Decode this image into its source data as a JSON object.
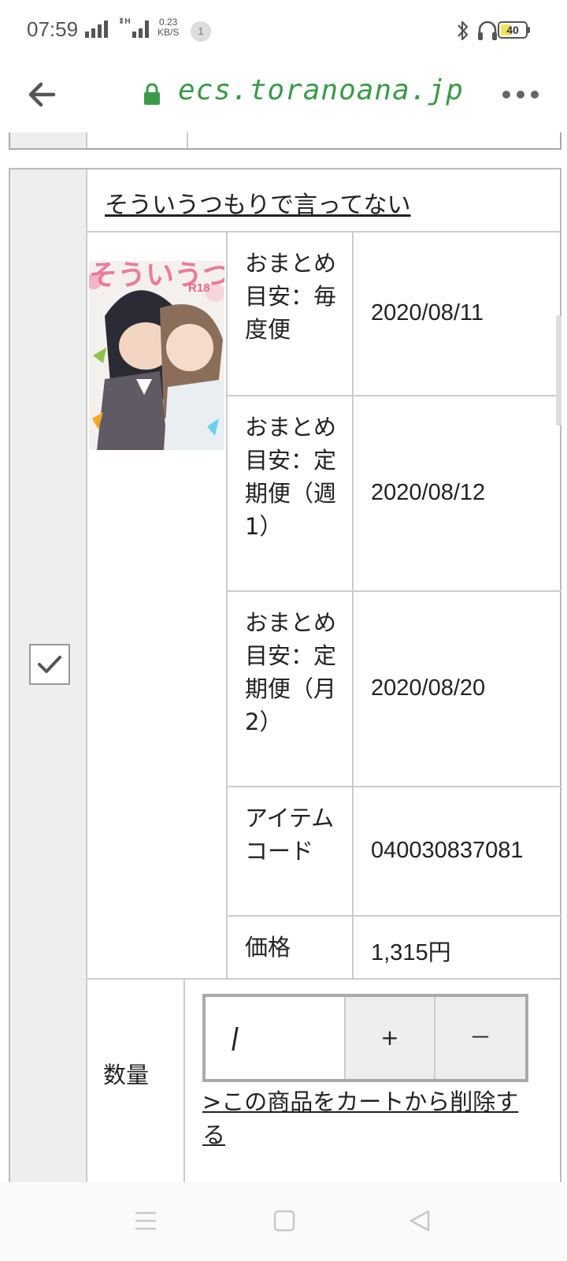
{
  "status_bar": {
    "time": "07:59",
    "net_speed_value": "0.23",
    "net_speed_unit": "KB/S",
    "notification_count": "1",
    "battery": "40"
  },
  "browser": {
    "url": "ecs.toranoana.jp",
    "icons": [
      "back-arrow-icon",
      "lock-icon",
      "more-icon"
    ],
    "accent_color": "#3a9a4a"
  },
  "item": {
    "title": "そういうつもりで言ってない",
    "checked": true,
    "cover": {
      "title_text": "そういうつもりで言ってない",
      "rating_badge": "R18"
    },
    "details": [
      {
        "label": "おまとめ目安：毎度便",
        "value": "2020/08/11"
      },
      {
        "label": "おまとめ目安：定期便（週1）",
        "value": "2020/08/12"
      },
      {
        "label": "おまとめ目安：定期便（月2）",
        "value": "2020/08/20"
      },
      {
        "label": "アイテムコード",
        "value": "040030837081"
      },
      {
        "label": "価格",
        "value": "1,315円"
      }
    ],
    "quantity": {
      "label": "数量",
      "value": "",
      "plus": "+",
      "minus": "－"
    },
    "delete_link": ">この商品をカートから削除する"
  },
  "nav_bar": {
    "icons": [
      "menu-icon",
      "home-icon",
      "back-icon"
    ]
  }
}
